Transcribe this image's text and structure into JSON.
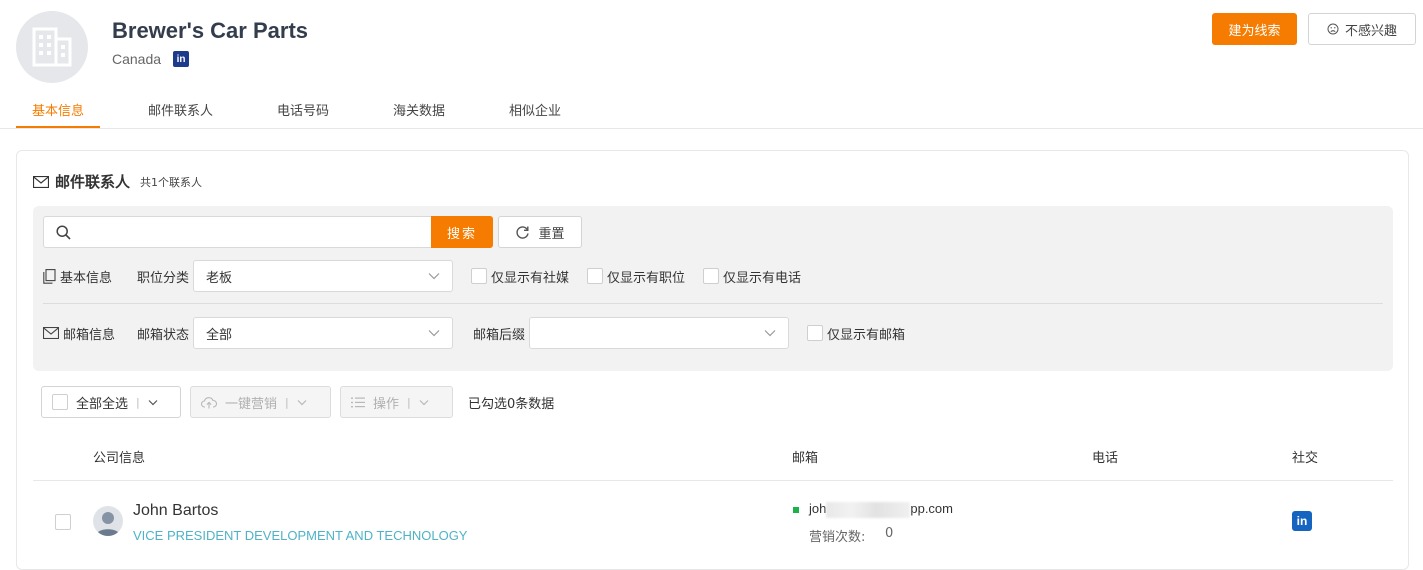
{
  "company": {
    "name": "Brewer's Car Parts",
    "country": "Canada",
    "linkedin_icon_text": "in"
  },
  "actions": {
    "create_lead": "建为线索",
    "not_interested": "不感兴趣"
  },
  "tabs": [
    {
      "label": "基本信息",
      "active": true
    },
    {
      "label": "邮件联系人",
      "active": false
    },
    {
      "label": "电话号码",
      "active": false
    },
    {
      "label": "海关数据",
      "active": false
    },
    {
      "label": "相似企业",
      "active": false
    }
  ],
  "section": {
    "title": "邮件联系人",
    "count_text": "共1个联系人"
  },
  "search": {
    "placeholder": "",
    "search_button": "搜索",
    "reset_button": "重置"
  },
  "filters": {
    "basic_group_label": "基本信息",
    "position_label": "职位分类",
    "position_value": "老板",
    "only_social": "仅显示有社媒",
    "only_position": "仅显示有职位",
    "only_phone": "仅显示有电话",
    "email_group_label": "邮箱信息",
    "email_status_label": "邮箱状态",
    "email_status_value": "全部",
    "email_suffix_label": "邮箱后缀",
    "email_suffix_value": "",
    "only_email": "仅显示有邮箱"
  },
  "toolbar": {
    "select_all": "全部全选",
    "one_click_marketing": "一键营销",
    "operations": "操作",
    "selected_text": "已勾选0条数据"
  },
  "table": {
    "columns": {
      "company_info": "公司信息",
      "email": "邮箱",
      "phone": "电话",
      "social": "社交"
    },
    "rows": [
      {
        "name": "John Bartos",
        "title": "VICE PRESIDENT DEVELOPMENT AND TECHNOLOGY",
        "email_prefix": "joh",
        "email_suffix": "pp.com",
        "marketing_label": "营销次数:",
        "marketing_count": "0",
        "social_icon_text": "in",
        "email_status_color": "#19b34a"
      }
    ]
  },
  "colors": {
    "accent": "#f57c00",
    "title_link": "#4fb3c6",
    "linkedin": "#1565c0"
  }
}
